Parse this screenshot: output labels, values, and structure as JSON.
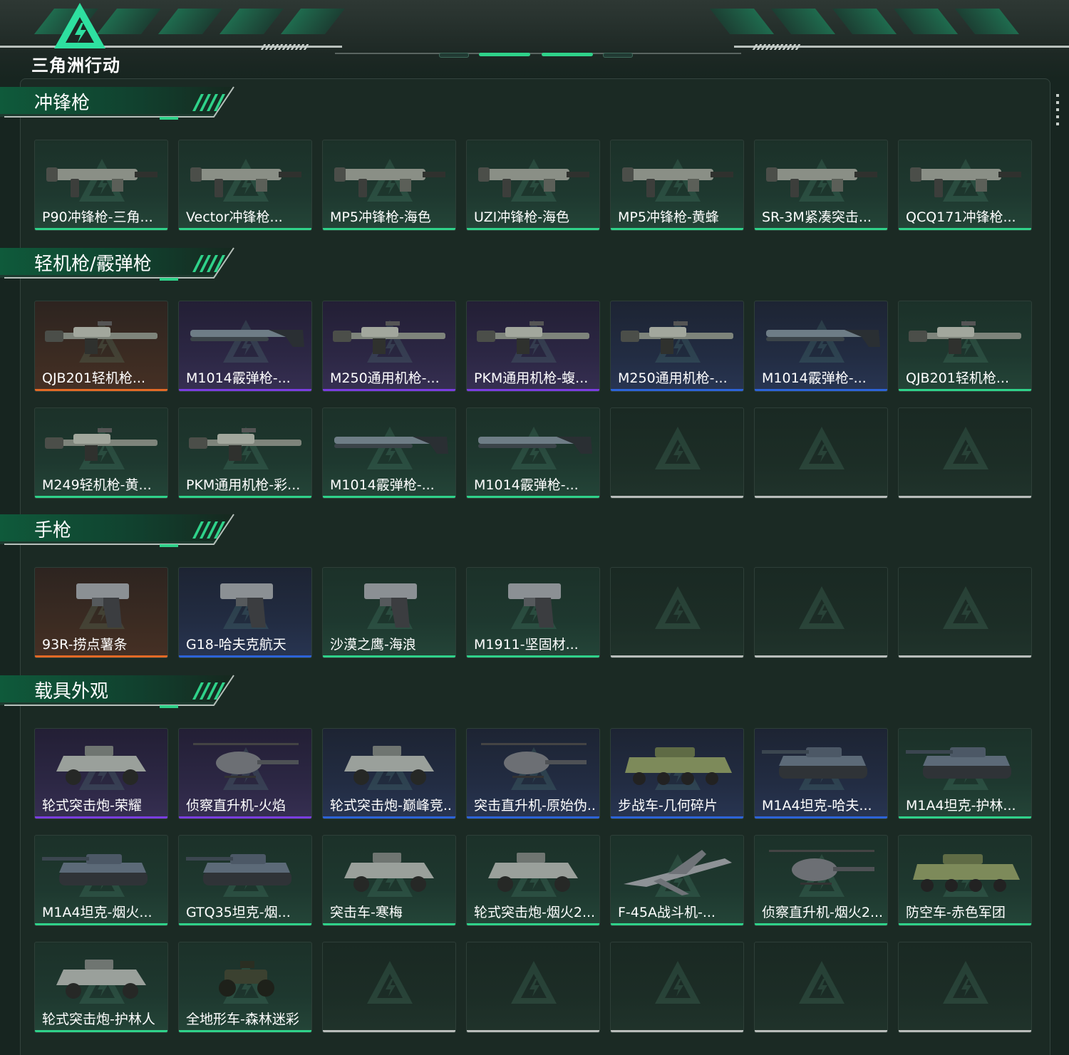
{
  "brand": {
    "logo_text": "三角洲行动",
    "accent": "#2fd28a"
  },
  "rarity_colors": {
    "green": "#2fd28a",
    "orange": "#e36a26",
    "purple": "#7a3de0",
    "blue": "#2c63d8",
    "empty": "#b9bdbb"
  },
  "sections": [
    {
      "title": "冲锋枪",
      "items": [
        {
          "name": "P90冲锋枪-三角...",
          "rarity": "green",
          "icon": "smg-icon"
        },
        {
          "name": "Vector冲锋枪...",
          "rarity": "green",
          "icon": "smg-icon"
        },
        {
          "name": "MP5冲锋枪-海色",
          "rarity": "green",
          "icon": "smg-icon"
        },
        {
          "name": "UZI冲锋枪-海色",
          "rarity": "green",
          "icon": "smg-icon"
        },
        {
          "name": "MP5冲锋枪-黄蜂",
          "rarity": "green",
          "icon": "smg-icon"
        },
        {
          "name": "SR-3M紧凑突击...",
          "rarity": "green",
          "icon": "smg-icon"
        },
        {
          "name": "QCQ171冲锋枪...",
          "rarity": "green",
          "icon": "smg-icon"
        }
      ]
    },
    {
      "title": "轻机枪/霰弹枪",
      "items": [
        {
          "name": "QJB201轻机枪...",
          "rarity": "orange",
          "icon": "lmg-icon"
        },
        {
          "name": "M1014霰弹枪-...",
          "rarity": "purple",
          "icon": "shotgun-icon"
        },
        {
          "name": "M250通用机枪-...",
          "rarity": "purple",
          "icon": "lmg-icon"
        },
        {
          "name": "PKM通用机枪-蝮...",
          "rarity": "purple",
          "icon": "lmg-icon"
        },
        {
          "name": "M250通用机枪-...",
          "rarity": "blue",
          "icon": "lmg-icon"
        },
        {
          "name": "M1014霰弹枪-...",
          "rarity": "blue",
          "icon": "shotgun-icon"
        },
        {
          "name": "QJB201轻机枪...",
          "rarity": "green",
          "icon": "lmg-icon"
        },
        {
          "name": "M249轻机枪-黄...",
          "rarity": "green",
          "icon": "lmg-icon"
        },
        {
          "name": "PKM通用机枪-彩...",
          "rarity": "green",
          "icon": "lmg-icon"
        },
        {
          "name": "M1014霰弹枪-...",
          "rarity": "green",
          "icon": "shotgun-icon"
        },
        {
          "name": "M1014霰弹枪-...",
          "rarity": "green",
          "icon": "shotgun-icon"
        },
        {
          "name": "",
          "rarity": "empty"
        },
        {
          "name": "",
          "rarity": "empty"
        },
        {
          "name": "",
          "rarity": "empty"
        }
      ]
    },
    {
      "title": "手枪",
      "items": [
        {
          "name": "93R-捞点薯条",
          "rarity": "orange",
          "icon": "pistol-icon"
        },
        {
          "name": "G18-哈夫克航天",
          "rarity": "blue",
          "icon": "pistol-icon"
        },
        {
          "name": "沙漠之鹰-海浪",
          "rarity": "green",
          "icon": "pistol-icon"
        },
        {
          "name": "M1911-坚固材...",
          "rarity": "green",
          "icon": "pistol-icon"
        },
        {
          "name": "",
          "rarity": "empty"
        },
        {
          "name": "",
          "rarity": "empty"
        },
        {
          "name": "",
          "rarity": "empty"
        }
      ]
    },
    {
      "title": "载具外观",
      "items": [
        {
          "name": "轮式突击炮-荣耀",
          "rarity": "purple",
          "icon": "armored-car-icon"
        },
        {
          "name": "侦察直升机-火焰",
          "rarity": "purple",
          "icon": "helicopter-icon"
        },
        {
          "name": "轮式突击炮-巅峰竞...",
          "rarity": "blue",
          "icon": "armored-car-icon"
        },
        {
          "name": "突击直升机-原始伪...",
          "rarity": "blue",
          "icon": "helicopter-icon"
        },
        {
          "name": "步战车-几何碎片",
          "rarity": "blue",
          "icon": "ifv-icon"
        },
        {
          "name": "M1A4坦克-哈夫...",
          "rarity": "blue",
          "icon": "tank-icon"
        },
        {
          "name": "M1A4坦克-护林...",
          "rarity": "green",
          "icon": "tank-icon"
        },
        {
          "name": "M1A4坦克-烟火...",
          "rarity": "green",
          "icon": "tank-icon"
        },
        {
          "name": "GTQ35坦克-烟...",
          "rarity": "green",
          "icon": "tank-icon"
        },
        {
          "name": "突击车-寒梅",
          "rarity": "green",
          "icon": "armored-car-icon"
        },
        {
          "name": "轮式突击炮-烟火2...",
          "rarity": "green",
          "icon": "armored-car-icon"
        },
        {
          "name": "F-45A战斗机-...",
          "rarity": "green",
          "icon": "fighter-jet-icon"
        },
        {
          "name": "侦察直升机-烟火2...",
          "rarity": "green",
          "icon": "helicopter-icon"
        },
        {
          "name": "防空车-赤色军团",
          "rarity": "green",
          "icon": "ifv-icon"
        },
        {
          "name": "轮式突击炮-护林人",
          "rarity": "green",
          "icon": "armored-car-icon"
        },
        {
          "name": "全地形车-森林迷彩",
          "rarity": "green",
          "icon": "atv-icon"
        },
        {
          "name": "",
          "rarity": "empty"
        },
        {
          "name": "",
          "rarity": "empty"
        },
        {
          "name": "",
          "rarity": "empty"
        },
        {
          "name": "",
          "rarity": "empty"
        },
        {
          "name": "",
          "rarity": "empty"
        }
      ]
    }
  ]
}
